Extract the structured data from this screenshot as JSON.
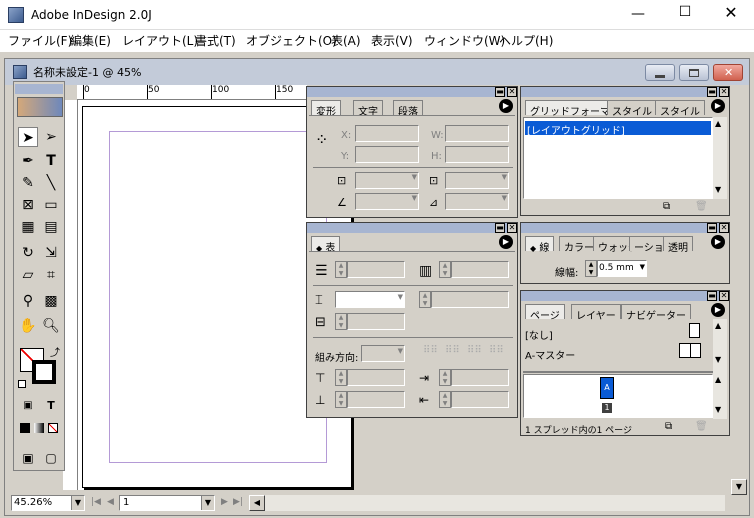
{
  "app": {
    "title": "Adobe InDesign 2.0J",
    "icon": "indesign-app-icon"
  },
  "menu": [
    "ファイル(F)",
    "編集(E)",
    "レイアウト(L)",
    "書式(T)",
    "オブジェクト(O)",
    "表(A)",
    "表示(V)",
    "ウィンドウ(W)",
    "ヘルプ(H)"
  ],
  "document": {
    "title": "名称未設定-1 @ 45%"
  },
  "ruler": {
    "ticks": [
      "0",
      "50",
      "100",
      "150"
    ]
  },
  "transform_panel": {
    "tabs": [
      "変形",
      "文字",
      "段落"
    ],
    "labels": {
      "x": "X:",
      "y": "Y:",
      "w": "W:",
      "h": "H:"
    }
  },
  "grid_panel": {
    "tabs": [
      "グリッドフォーマット",
      "スタイル",
      "スタイル"
    ],
    "items": [
      "[レイアウトグリッド]"
    ]
  },
  "table_panel": {
    "tabs": [
      "表"
    ],
    "direction_label": "組み方向:"
  },
  "stroke_panel": {
    "tabs": [
      "線",
      "カラー",
      "ウォッチ",
      "ーション",
      "透明"
    ],
    "weight_label": "線幅:",
    "weight_value": "0.5 mm"
  },
  "pages_panel": {
    "tabs": [
      "ページ",
      "レイヤー",
      "ナビゲーター"
    ],
    "masters": [
      "[なし]",
      "A-マスター"
    ],
    "page_letter": "A",
    "page_number": "1",
    "status": "1 スプレッド内の1 ページ"
  },
  "statusbar": {
    "zoom": "45.26%",
    "page": "1"
  }
}
